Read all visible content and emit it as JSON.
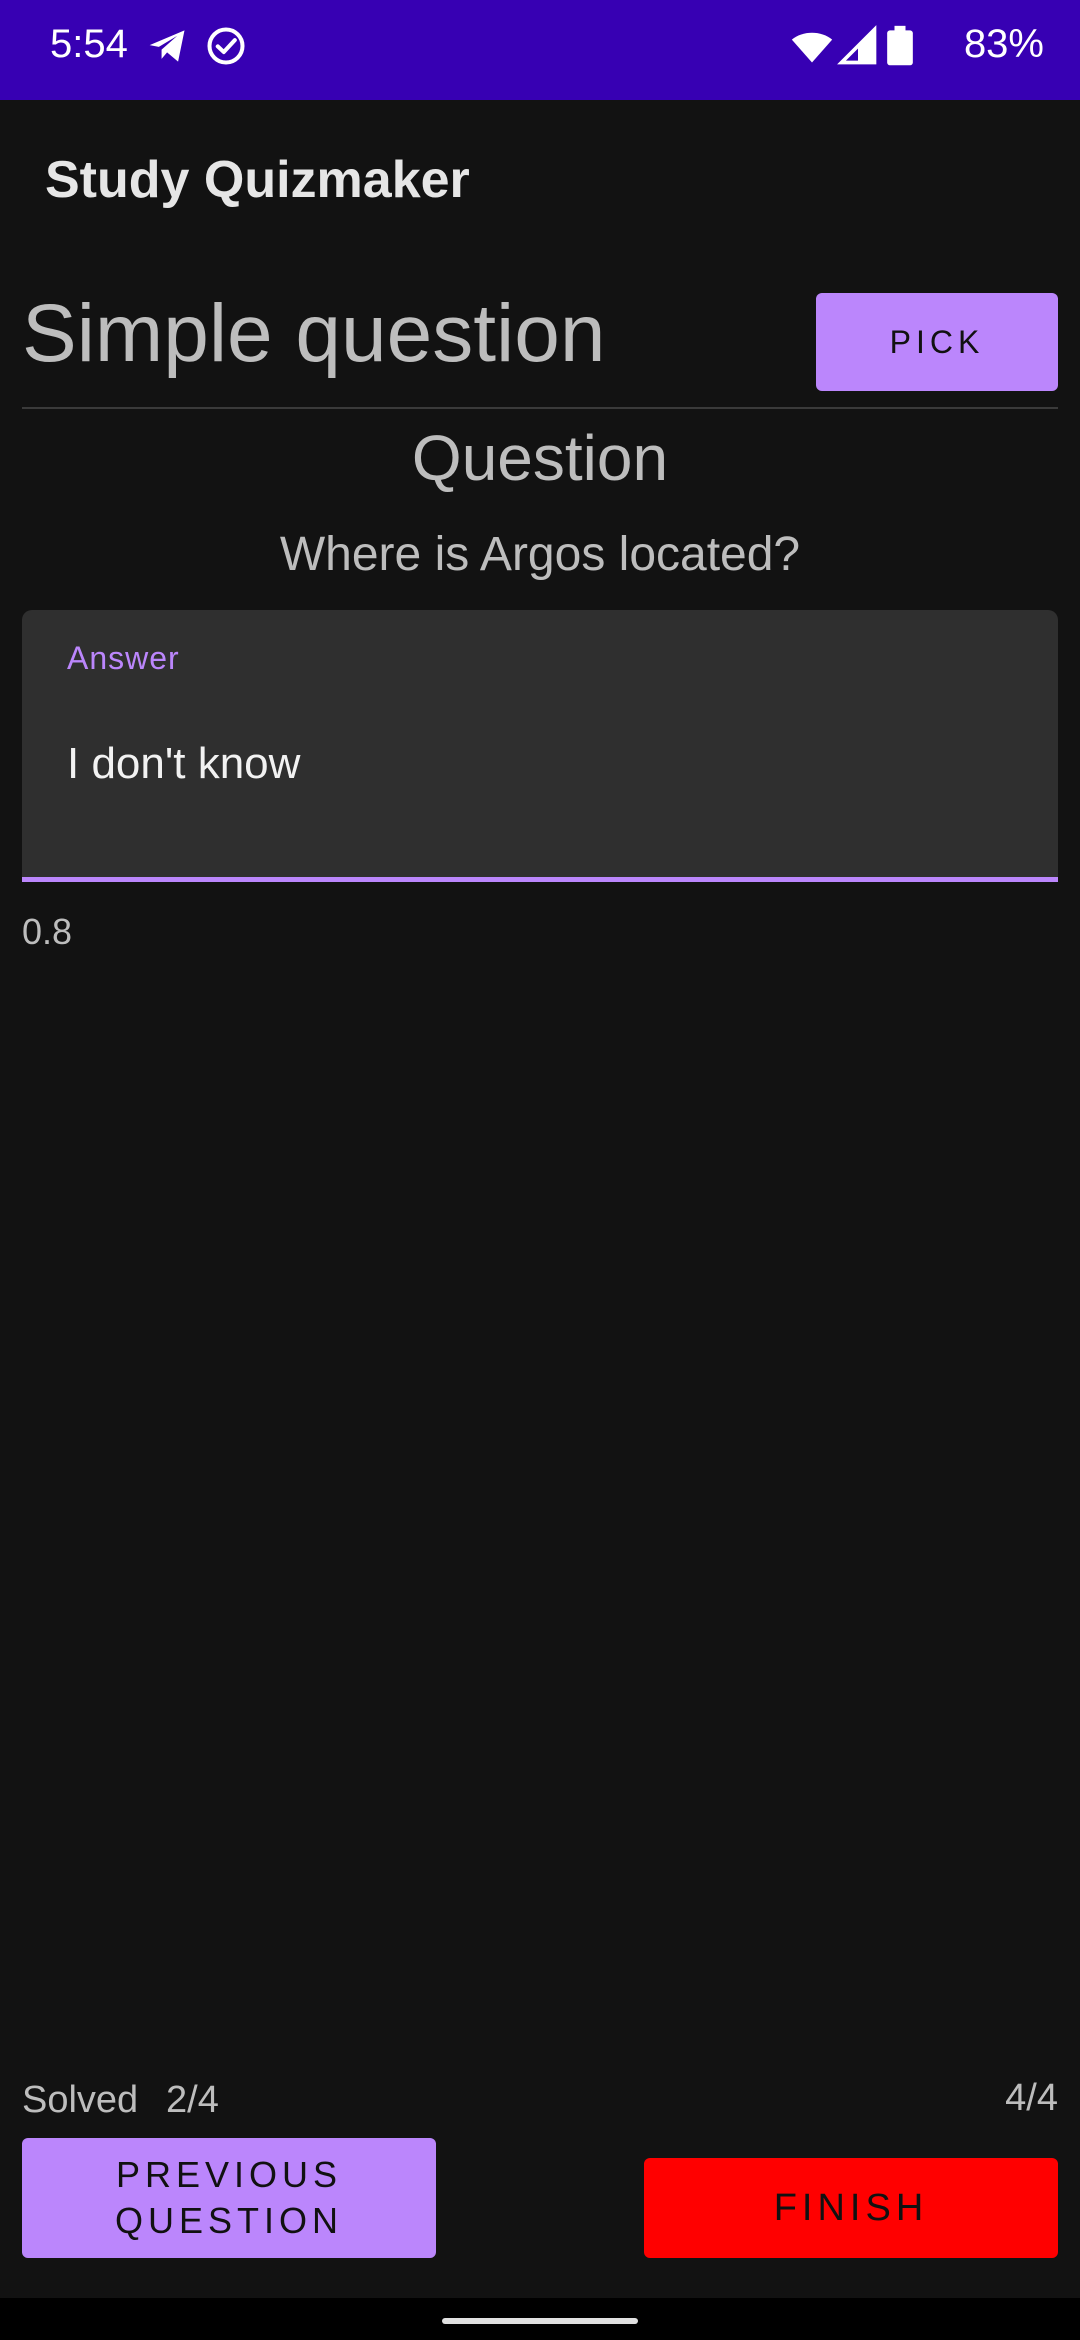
{
  "status_bar": {
    "time": "5:54",
    "battery_percent": "83%",
    "background_color": "#3700b3",
    "icons": [
      "telegram-icon",
      "check-circle-icon",
      "wifi-icon",
      "signal-icon",
      "battery-icon"
    ]
  },
  "app_bar": {
    "title": "Study Quizmaker"
  },
  "mode": {
    "title": "Simple question",
    "pick_label": "PICK"
  },
  "question": {
    "heading": "Question",
    "text": "Where is Argos located?"
  },
  "answer": {
    "label": "Answer",
    "value": "I don't know",
    "accent_color": "#bb86fc"
  },
  "score": "0.8",
  "footer": {
    "solved_label": "Solved",
    "solved_value": "2/4",
    "position_value": "4/4",
    "previous_label": "PREVIOUS QUESTION",
    "finish_label": "FINISH",
    "finish_color": "#ff0000"
  }
}
